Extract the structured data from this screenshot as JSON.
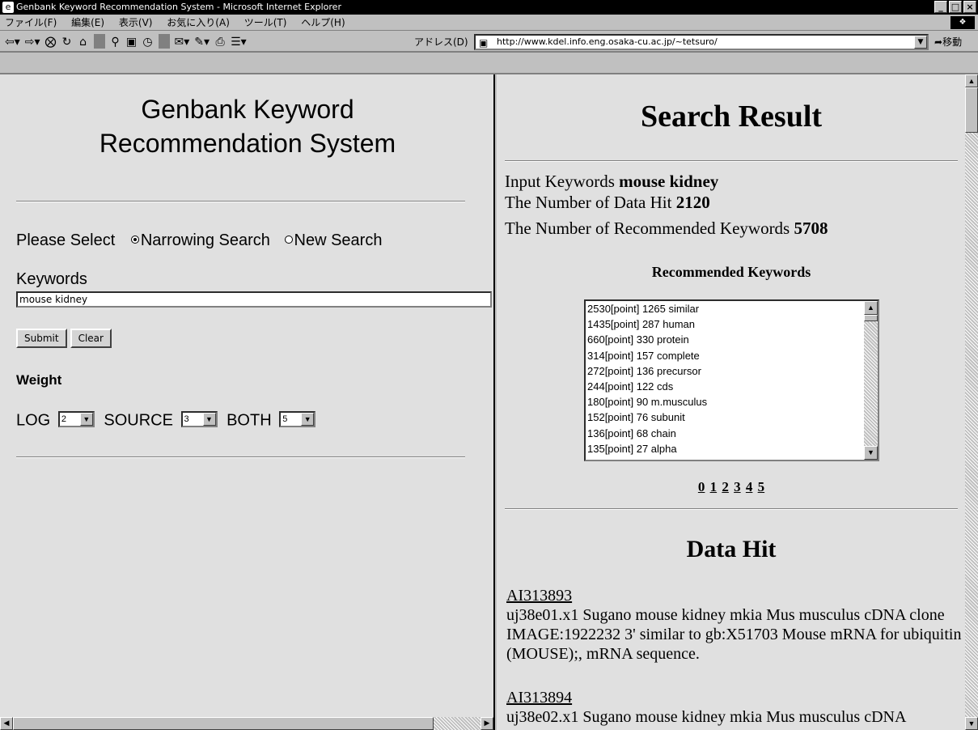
{
  "window": {
    "title": "Genbank Keyword Recommendation System - Microsoft Internet Explorer",
    "minimize": "_",
    "maximize": "□",
    "close": "×"
  },
  "menu": [
    "ファイル(F)",
    "編集(E)",
    "表示(V)",
    "お気に入り(A)",
    "ツール(T)",
    "ヘルプ(H)"
  ],
  "toolbar": {
    "address_label": "アドレス(D)",
    "address": "http://www.kdel.info.eng.osaka-cu.ac.jp/~tetsuro/",
    "go_label": "移動"
  },
  "left": {
    "title_line1": "Genbank Keyword",
    "title_line2": "Recommendation System",
    "select_label": "Please Select",
    "option_narrowing": "Narrowing Search",
    "option_new": "New Search",
    "keywords_label": "Keywords",
    "keywords_value": "mouse kidney",
    "submit_label": "Submit",
    "clear_label": "Clear",
    "weight_label": "Weight",
    "log_label": "LOG",
    "log_value": "2",
    "source_label": "SOURCE",
    "source_value": "3",
    "both_label": "BOTH",
    "both_value": "5"
  },
  "right": {
    "title": "Search Result",
    "input_keywords_label": "Input Keywords",
    "input_keywords_value": "mouse kidney",
    "data_hit_label": "The Number of Data Hit",
    "data_hit_value": "2120",
    "rec_count_label": "The Number of Recommended Keywords",
    "rec_count_value": "5708",
    "rec_heading": "Recommended Keywords",
    "rec_list": [
      "2530[point] 1265 similar",
      "1435[point] 287 human",
      "660[point] 330 protein",
      "314[point] 157 complete",
      "272[point] 136 precursor",
      "244[point] 122 cds",
      "180[point] 90 m.musculus",
      "152[point] 76 subunit",
      "136[point] 68 chain",
      "135[point] 27 alpha"
    ],
    "pages": [
      "0",
      "1",
      "2",
      "3",
      "4",
      "5"
    ],
    "data_hit_title": "Data Hit",
    "hits": [
      {
        "id": "AI313893",
        "desc": "uj38e01.x1 Sugano mouse kidney mkia Mus musculus cDNA clone IMAGE:1922232 3' similar to gb:X51703 Mouse mRNA for ubiquitin (MOUSE);, mRNA sequence."
      },
      {
        "id": "AI313894",
        "desc": "uj38e02.x1 Sugano mouse kidney mkia Mus musculus cDNA"
      }
    ]
  }
}
